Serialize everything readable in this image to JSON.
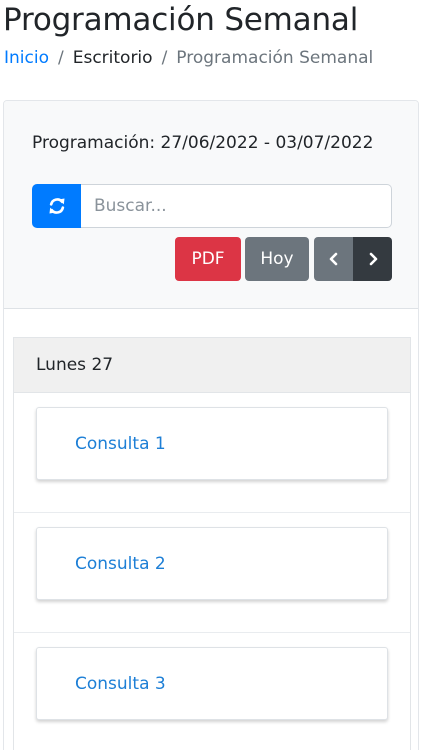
{
  "page": {
    "title": "Programación Semanal"
  },
  "breadcrumb": {
    "items": [
      "Inicio",
      "Escritorio",
      "Programación Semanal"
    ],
    "separator": "/"
  },
  "header": {
    "period_label": "Programación: 27/06/2022 - 03/07/2022",
    "refresh_icon": "refresh-icon",
    "search_placeholder": "Buscar...",
    "search_value": "",
    "pdf_label": "PDF",
    "today_label": "Hoy",
    "prev_icon": "chevron-left-icon",
    "next_icon": "chevron-right-icon"
  },
  "schedule": {
    "day_label": "Lunes 27",
    "items": [
      {
        "label": "Consulta 1"
      },
      {
        "label": "Consulta 2"
      },
      {
        "label": "Consulta 3"
      }
    ]
  },
  "colors": {
    "primary": "#007bff",
    "danger": "#dc3545",
    "secondary": "#6c757d",
    "dark": "#343a40",
    "link": "#1d7fd6"
  }
}
